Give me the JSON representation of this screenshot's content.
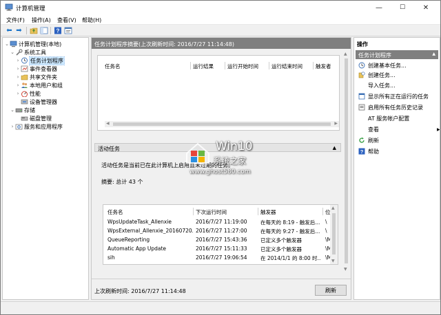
{
  "window": {
    "title": "计算机管理",
    "minimize_glyph": "—",
    "maximize_glyph": "☐",
    "close_glyph": "✕"
  },
  "menu": [
    "文件(F)",
    "操作(A)",
    "查看(V)",
    "帮助(H)"
  ],
  "toolbar": {
    "back_glyph": "⬅",
    "forward_glyph": "➡",
    "icons": [
      "back-arrow-icon",
      "forward-arrow-icon",
      "folder-up-icon",
      "show-hide-tree-icon",
      "help-icon",
      "properties-icon"
    ]
  },
  "tree": {
    "root": "计算机管理(本地)",
    "system_tools": "系统工具",
    "task_scheduler": "任务计划程序",
    "event_viewer": "事件查看器",
    "shared_folders": "共享文件夹",
    "local_users": "本地用户和组",
    "performance": "性能",
    "device_manager": "设备管理器",
    "storage": "存储",
    "disk_management": "磁盘管理",
    "services_apps": "服务和应用程序"
  },
  "center": {
    "header": "任务计划程序摘要(上次刷新时间: 2016/7/27 11:14:48)",
    "panel1_columns": [
      "任务名",
      "运行结果",
      "运行开始时间",
      "运行结束时间",
      "触发者"
    ],
    "active_tasks_title": "活动任务",
    "active_tasks_desc": "活动任务是当前已在此计算机上启用且未过期的任务。",
    "summary": "摘要: 总计 43 个",
    "task_columns": [
      "任务名",
      "下次运行时间",
      "触发器",
      "位"
    ],
    "tasks": [
      {
        "name": "WpsUpdateTask_Allenxie",
        "next": "2016/7/27 11:19:00",
        "trigger": "在每天的 8:19 - 触发后...",
        "loc": "\\"
      },
      {
        "name": "WpsExternal_Allenxie_20160720...",
        "next": "2016/7/27 11:27:00",
        "trigger": "在每天的 9:27 - 触发后...",
        "loc": "\\"
      },
      {
        "name": "QueueReporting",
        "next": "2016/7/27 15:43:36",
        "trigger": "已定义多个触发器",
        "loc": "\\M"
      },
      {
        "name": "Automatic App Update",
        "next": "2016/7/27 15:11:33",
        "trigger": "已定义多个触发器",
        "loc": "\\M"
      },
      {
        "name": "sih",
        "next": "2016/7/27 19:06:54",
        "trigger": "在 2014/1/1 的 8:00 时...",
        "loc": "\\M"
      }
    ],
    "footer_text": "上次刷新时间: 2016/7/27 11:14:48",
    "refresh_button": "刷新"
  },
  "actions": {
    "header": "操作",
    "section": "任务计划程序",
    "items": [
      "创建基本任务...",
      "创建任务...",
      "导入任务...",
      "显示所有正在运行的任务",
      "启用所有任务历史记录",
      "AT 服务帐户配置",
      "查看",
      "刷新",
      "帮助"
    ]
  },
  "watermark": {
    "big": "Win10",
    "cn": "系统之家",
    "url": "www.ghost580.com"
  },
  "colors": {
    "header_gray": "#7f7f7f",
    "selection": "#cce8ff",
    "accent_blue": "#1a73c8"
  }
}
